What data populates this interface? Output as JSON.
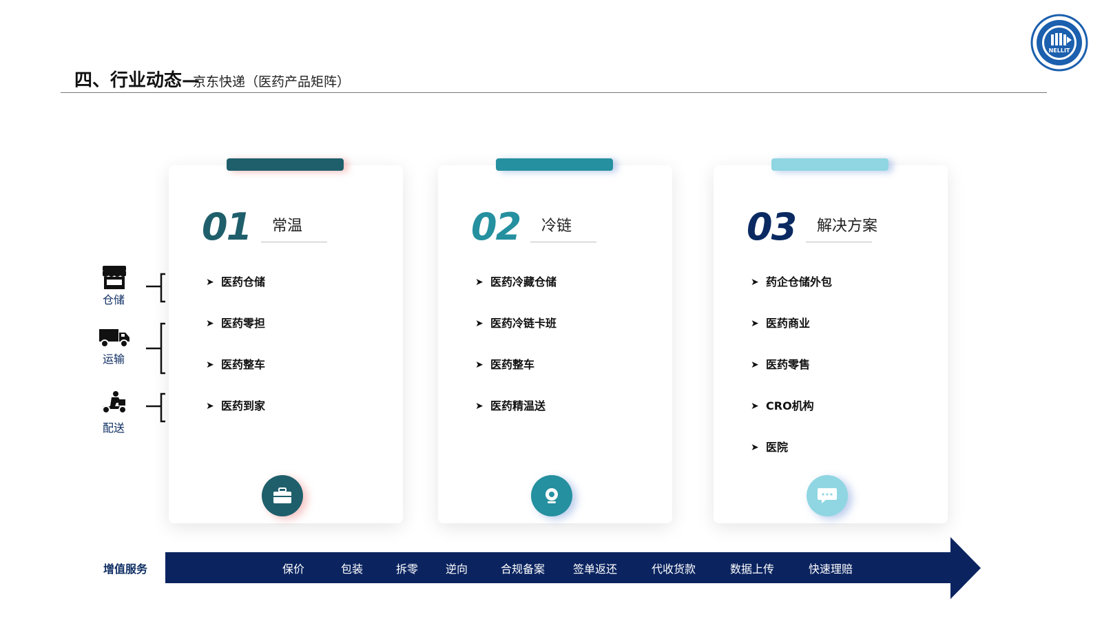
{
  "header": {
    "title": "四、行业动态—",
    "subtitle": "京东快递（医药产品矩阵）",
    "logo_text": "NELLIT"
  },
  "legend": [
    {
      "label": "仓储",
      "icon": "store-icon"
    },
    {
      "label": "运输",
      "icon": "truck-icon"
    },
    {
      "label": "配送",
      "icon": "courier-icon"
    }
  ],
  "cards": [
    {
      "number": "01",
      "name": "常温",
      "color": "#1f5f6b",
      "items": [
        "医药仓储",
        "医药零担",
        "医药整车",
        "医药到家"
      ],
      "badge_icon": "briefcase-icon"
    },
    {
      "number": "02",
      "name": "冷链",
      "color": "#25909f",
      "items": [
        "医药冷藏仓储",
        "医药冷链卡班",
        "医药整车",
        "医药精温送"
      ],
      "badge_icon": "webcam-icon"
    },
    {
      "number": "03",
      "name": "解决方案",
      "number_color": "#0b2a62",
      "color": "#8fd6e2",
      "items": [
        "药企仓储外包",
        "医药商业",
        "医药零售",
        "CRO机构",
        "医院"
      ],
      "badge_icon": "chat-icon"
    }
  ],
  "value_added": {
    "label": "增值服务",
    "services": [
      "保价",
      "包装",
      "拆零",
      "逆向",
      "合规备案",
      "签单返还",
      "代收货款",
      "数据上传",
      "快速理赔"
    ],
    "bar_color": "#0b2460"
  }
}
